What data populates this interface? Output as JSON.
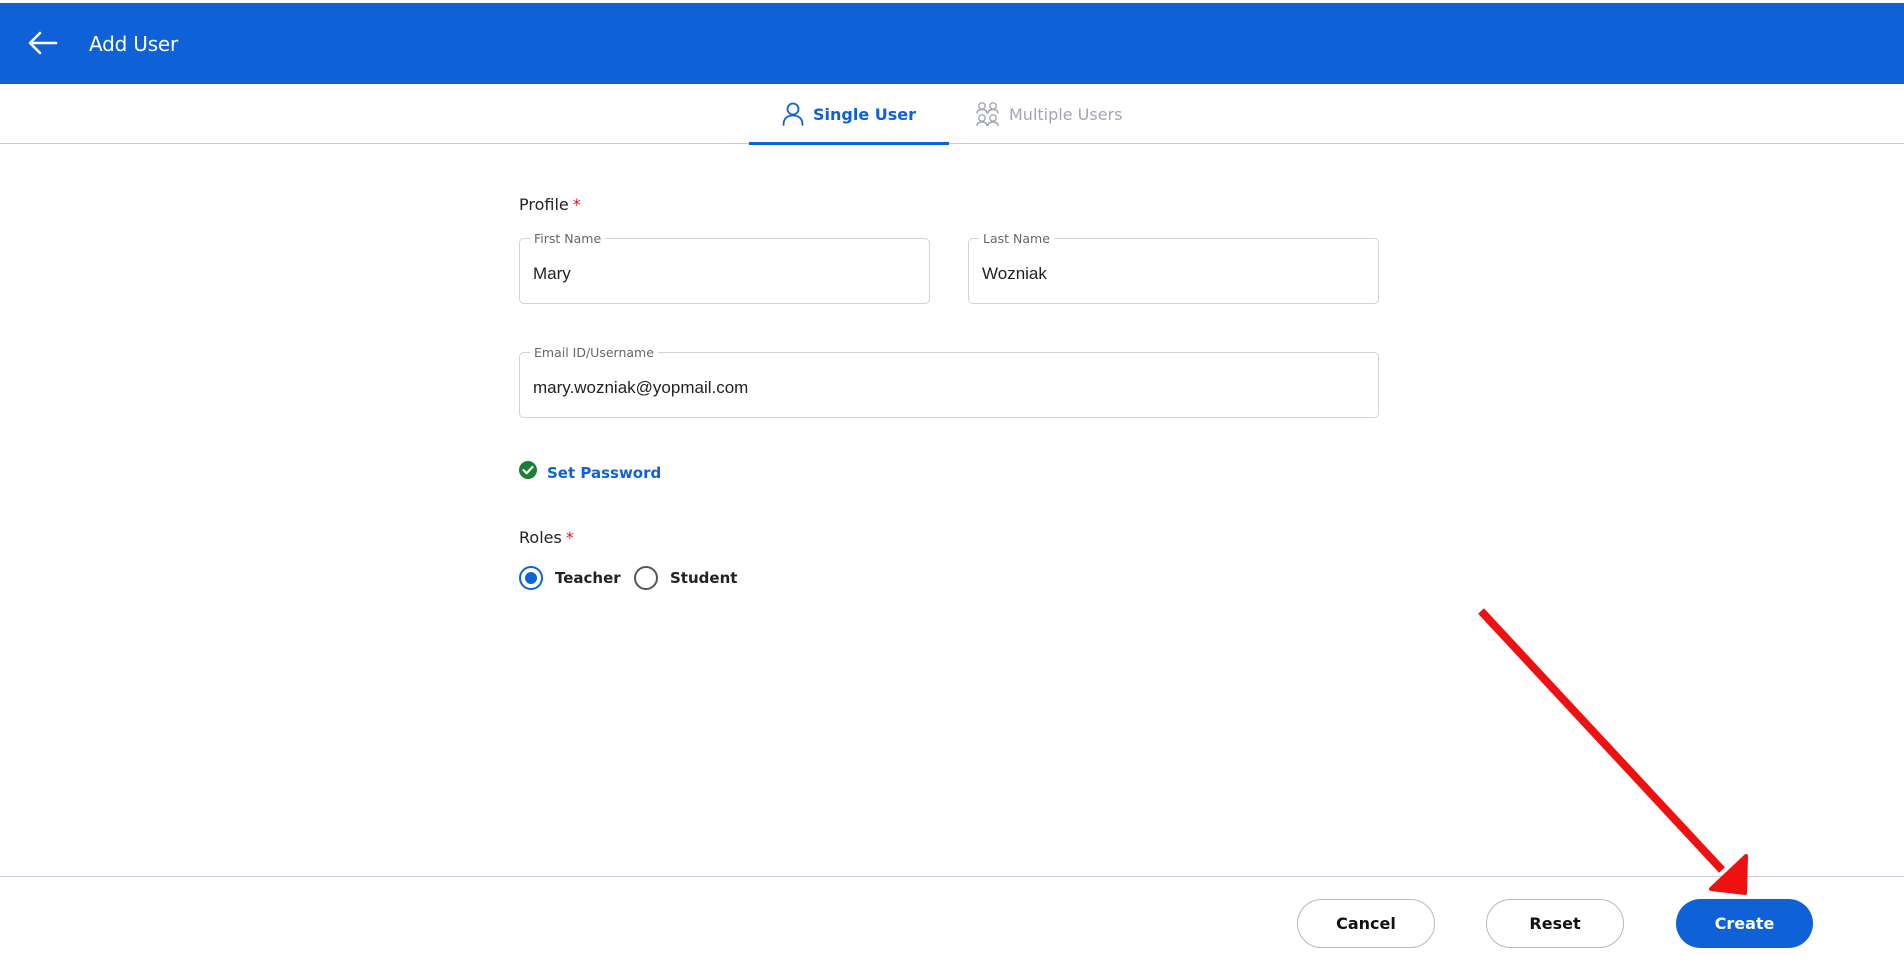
{
  "header": {
    "title": "Add User",
    "back_icon": "arrow-left-icon",
    "background": "#0f61d8"
  },
  "tabs": [
    {
      "label": "Single User",
      "icon": "person-icon",
      "active": true
    },
    {
      "label": "Multiple Users",
      "icon": "people-icon",
      "active": false
    }
  ],
  "form": {
    "profile_label": "Profile",
    "required_mark": "*",
    "first_name": {
      "label": "First Name",
      "value": "Mary"
    },
    "last_name": {
      "label": "Last Name",
      "value": "Wozniak"
    },
    "email": {
      "label": "Email ID/Username",
      "value": "mary.wozniak@yopmail.com"
    },
    "set_password": {
      "label": "Set Password",
      "icon": "check-circle-icon",
      "status_color": "#1a7f37"
    },
    "roles_label": "Roles",
    "roles": [
      {
        "label": "Teacher",
        "selected": true
      },
      {
        "label": "Student",
        "selected": false
      }
    ]
  },
  "footer": {
    "cancel_label": "Cancel",
    "reset_label": "Reset",
    "create_label": "Create"
  },
  "annotation": {
    "type": "arrow",
    "color": "#ee1111",
    "target": "create-button"
  }
}
